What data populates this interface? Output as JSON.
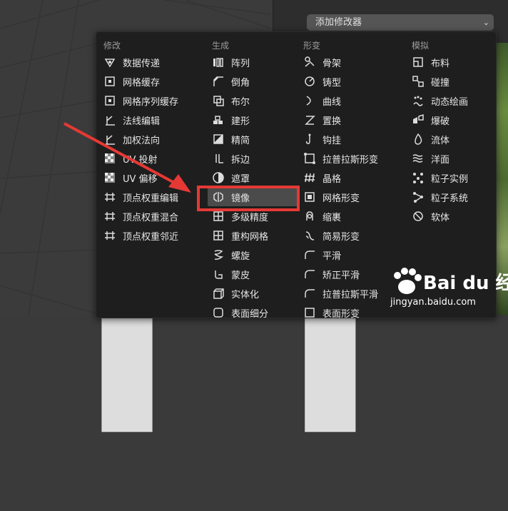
{
  "properties": {
    "add_modifier": "添加修改器"
  },
  "menu": {
    "columns": [
      {
        "heading": "修改",
        "items": [
          {
            "label": "数据传递",
            "icon": "data-transfer-icon"
          },
          {
            "label": "网格缓存",
            "icon": "mesh-cache-icon"
          },
          {
            "label": "网格序列缓存",
            "icon": "mesh-sequence-cache-icon"
          },
          {
            "label": "法线编辑",
            "icon": "normal-edit-icon"
          },
          {
            "label": "加权法向",
            "icon": "weighted-normal-icon"
          },
          {
            "label": "UV 投射",
            "icon": "uv-project-icon"
          },
          {
            "label": "UV 偏移",
            "icon": "uv-warp-icon"
          },
          {
            "label": "顶点权重编辑",
            "icon": "vertex-weight-edit-icon"
          },
          {
            "label": "顶点权重混合",
            "icon": "vertex-weight-mix-icon"
          },
          {
            "label": "顶点权重邻近",
            "icon": "vertex-weight-proximity-icon"
          }
        ]
      },
      {
        "heading": "生成",
        "items": [
          {
            "label": "阵列",
            "icon": "array-icon"
          },
          {
            "label": "倒角",
            "icon": "bevel-icon"
          },
          {
            "label": "布尔",
            "icon": "boolean-icon"
          },
          {
            "label": "建形",
            "icon": "build-icon"
          },
          {
            "label": "精简",
            "icon": "decimate-icon"
          },
          {
            "label": "拆边",
            "icon": "edge-split-icon"
          },
          {
            "label": "遮罩",
            "icon": "mask-icon"
          },
          {
            "label": "镜像",
            "icon": "mirror-icon",
            "highlighted": true
          },
          {
            "label": "多级精度",
            "icon": "multires-icon"
          },
          {
            "label": "重构网格",
            "icon": "remesh-icon"
          },
          {
            "label": "螺旋",
            "icon": "screw-icon"
          },
          {
            "label": "蒙皮",
            "icon": "skin-icon"
          },
          {
            "label": "实体化",
            "icon": "solidify-icon"
          },
          {
            "label": "表面细分",
            "icon": "subdivision-icon"
          }
        ]
      },
      {
        "heading": "形变",
        "items": [
          {
            "label": "骨架",
            "icon": "armature-icon"
          },
          {
            "label": "铸型",
            "icon": "cast-icon"
          },
          {
            "label": "曲线",
            "icon": "curve-icon"
          },
          {
            "label": "置换",
            "icon": "displace-icon"
          },
          {
            "label": "钩挂",
            "icon": "hook-icon"
          },
          {
            "label": "拉普拉斯形变",
            "icon": "laplacian-deform-icon"
          },
          {
            "label": "晶格",
            "icon": "lattice-icon"
          },
          {
            "label": "网格形变",
            "icon": "mesh-deform-icon"
          },
          {
            "label": "缩裹",
            "icon": "shrinkwrap-icon"
          },
          {
            "label": "简易形变",
            "icon": "simple-deform-icon"
          },
          {
            "label": "平滑",
            "icon": "smooth-icon"
          },
          {
            "label": "矫正平滑",
            "icon": "corrective-smooth-icon"
          },
          {
            "label": "拉普拉斯平滑",
            "icon": "laplacian-smooth-icon"
          },
          {
            "label": "表面形变",
            "icon": "surface-deform-icon"
          }
        ]
      },
      {
        "heading": "模拟",
        "items": [
          {
            "label": "布料",
            "icon": "cloth-icon"
          },
          {
            "label": "碰撞",
            "icon": "collision-icon"
          },
          {
            "label": "动态绘画",
            "icon": "dynamic-paint-icon"
          },
          {
            "label": "爆破",
            "icon": "explode-icon"
          },
          {
            "label": "流体",
            "icon": "fluid-icon"
          },
          {
            "label": "洋面",
            "icon": "ocean-icon"
          },
          {
            "label": "粒子实例",
            "icon": "particle-instance-icon"
          },
          {
            "label": "粒子系统",
            "icon": "particle-system-icon"
          },
          {
            "label": "软体",
            "icon": "soft-body-icon"
          }
        ]
      }
    ]
  },
  "watermark": {
    "logo": "Bai du 经验",
    "url": "jingyan.baidu.com"
  },
  "colors": {
    "menu_bg": "#1e1e1e",
    "highlight_red": "#e53935",
    "text": "#e6e6e6",
    "heading": "#9c9c9c"
  }
}
